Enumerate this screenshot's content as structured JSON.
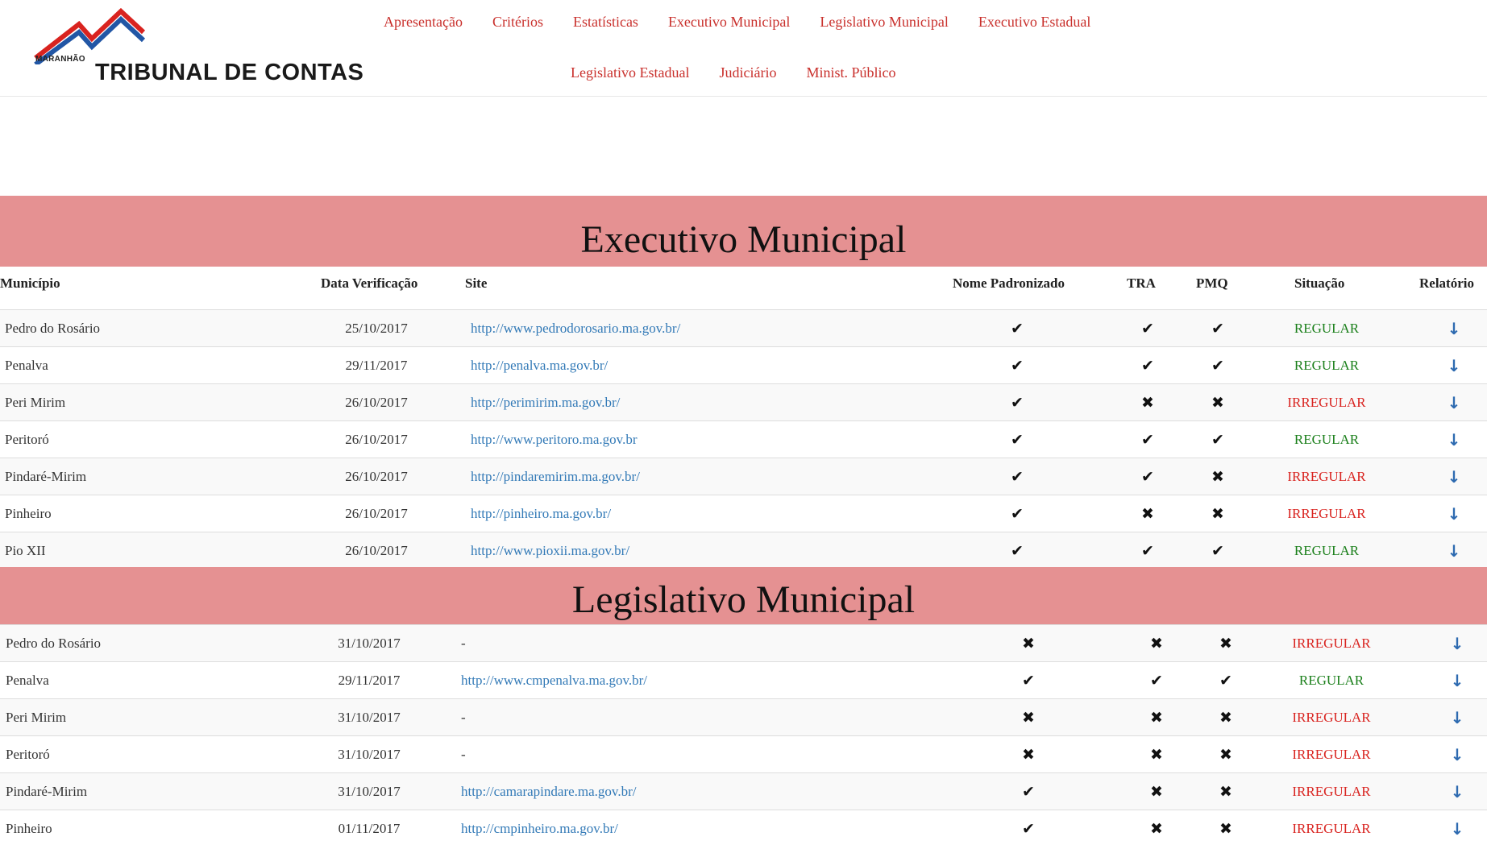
{
  "logo": {
    "state": "MARANHÃO",
    "name": "TRIBUNAL DE CONTAS"
  },
  "nav": {
    "row1": [
      "Apresentação",
      "Critérios",
      "Estatísticas",
      "Executivo Municipal",
      "Legislativo Municipal",
      "Executivo Estadual"
    ],
    "row2": [
      "Legislativo Estadual",
      "Judiciário",
      "Minist. Público"
    ]
  },
  "columns": [
    "Município",
    "Data Verificação",
    "Site",
    "Nome Padronizado",
    "TRA",
    "PMQ",
    "Situação",
    "Relatório"
  ],
  "sections": [
    {
      "title": "Executivo Municipal",
      "rows": [
        {
          "municipio": "Pedro do Rosário",
          "data": "25/10/2017",
          "site": "http://www.pedrodorosario.ma.gov.br/",
          "nome": "check",
          "tra": "check",
          "pmq": "check",
          "situacao": "REGULAR"
        },
        {
          "municipio": "Penalva",
          "data": "29/11/2017",
          "site": "http://penalva.ma.gov.br/",
          "nome": "check",
          "tra": "check",
          "pmq": "check",
          "situacao": "REGULAR"
        },
        {
          "municipio": "Peri Mirim",
          "data": "26/10/2017",
          "site": "http://perimirim.ma.gov.br/",
          "nome": "check",
          "tra": "cross",
          "pmq": "cross",
          "situacao": "IRREGULAR"
        },
        {
          "municipio": "Peritoró",
          "data": "26/10/2017",
          "site": "http://www.peritoro.ma.gov.br",
          "nome": "check",
          "tra": "check",
          "pmq": "check",
          "situacao": "REGULAR"
        },
        {
          "municipio": "Pindaré-Mirim",
          "data": "26/10/2017",
          "site": "http://pindaremirim.ma.gov.br/",
          "nome": "check",
          "tra": "check",
          "pmq": "cross",
          "situacao": "IRREGULAR"
        },
        {
          "municipio": "Pinheiro",
          "data": "26/10/2017",
          "site": "http://pinheiro.ma.gov.br/",
          "nome": "check",
          "tra": "cross",
          "pmq": "cross",
          "situacao": "IRREGULAR"
        },
        {
          "municipio": "Pio XII",
          "data": "26/10/2017",
          "site": "http://www.pioxii.ma.gov.br/",
          "nome": "check",
          "tra": "check",
          "pmq": "check",
          "situacao": "REGULAR"
        }
      ]
    },
    {
      "title": "Legislativo Municipal",
      "rows": [
        {
          "municipio": "Pedro do Rosário",
          "data": "31/10/2017",
          "site": "-",
          "nome": "cross",
          "tra": "cross",
          "pmq": "cross",
          "situacao": "IRREGULAR"
        },
        {
          "municipio": "Penalva",
          "data": "29/11/2017",
          "site": "http://www.cmpenalva.ma.gov.br/",
          "nome": "check",
          "tra": "check",
          "pmq": "check",
          "situacao": "REGULAR"
        },
        {
          "municipio": "Peri Mirim",
          "data": "31/10/2017",
          "site": "-",
          "nome": "cross",
          "tra": "cross",
          "pmq": "cross",
          "situacao": "IRREGULAR"
        },
        {
          "municipio": "Peritoró",
          "data": "31/10/2017",
          "site": "-",
          "nome": "cross",
          "tra": "cross",
          "pmq": "cross",
          "situacao": "IRREGULAR"
        },
        {
          "municipio": "Pindaré-Mirim",
          "data": "31/10/2017",
          "site": "http://camarapindare.ma.gov.br/",
          "nome": "check",
          "tra": "cross",
          "pmq": "cross",
          "situacao": "IRREGULAR"
        },
        {
          "municipio": "Pinheiro",
          "data": "01/11/2017",
          "site": "http://cmpinheiro.ma.gov.br/",
          "nome": "check",
          "tra": "cross",
          "pmq": "cross",
          "situacao": "IRREGULAR"
        }
      ]
    }
  ],
  "colors": {
    "accent": "#c9302c",
    "band": "#e59192",
    "link": "#337ab7",
    "regular": "#1a7f1a",
    "irregular": "#d9231f"
  },
  "icons": {
    "check": "check-icon",
    "cross": "cross-icon",
    "download": "download-arrow-icon"
  }
}
